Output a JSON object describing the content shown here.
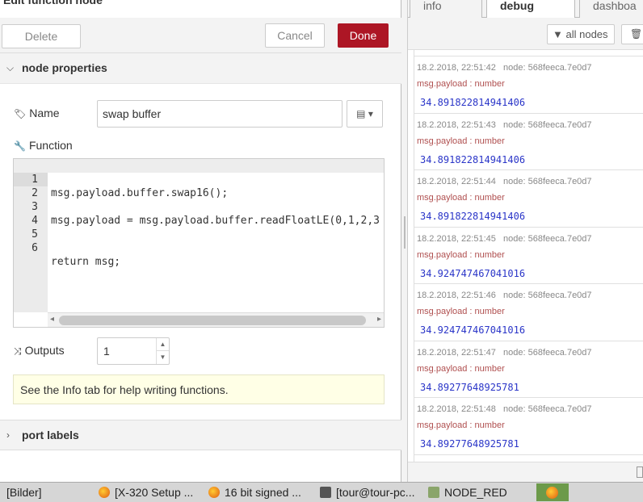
{
  "editor_tray": {
    "title": "Edit function node",
    "delete_label": "Delete",
    "cancel_label": "Cancel",
    "done_label": "Done",
    "section_properties": "node properties",
    "name_label": "Name",
    "name_value": "swap buffer",
    "function_label": "Function",
    "code_lines": [
      {
        "n": "1",
        "text": "msg.payload.buffer.swap16();"
      },
      {
        "n": "2",
        "text": ""
      },
      {
        "n": "3",
        "text": "msg.payload = msg.payload.buffer.readFloatLE(0,1,2,3"
      },
      {
        "n": "4",
        "text": ""
      },
      {
        "n": "5",
        "text": ""
      },
      {
        "n": "6",
        "text": "return msg;"
      }
    ],
    "outputs_label": "Outputs",
    "outputs_value": "1",
    "tip": "See the Info tab for help writing functions.",
    "section_ports": "port labels"
  },
  "sidebar": {
    "tabs": [
      "info",
      "debug",
      "dashboa"
    ],
    "active_tab": "debug",
    "filter_label": "all nodes",
    "messages": [
      {
        "time": "18.2.2018, 22:51:42",
        "node": "node: 568feeca.7e0d7",
        "topic": "msg.payload : number",
        "value": "34.891822814941406"
      },
      {
        "time": "18.2.2018, 22:51:43",
        "node": "node: 568feeca.7e0d7",
        "topic": "msg.payload : number",
        "value": "34.891822814941406"
      },
      {
        "time": "18.2.2018, 22:51:44",
        "node": "node: 568feeca.7e0d7",
        "topic": "msg.payload : number",
        "value": "34.891822814941406"
      },
      {
        "time": "18.2.2018, 22:51:45",
        "node": "node: 568feeca.7e0d7",
        "topic": "msg.payload : number",
        "value": "34.924747467041016"
      },
      {
        "time": "18.2.2018, 22:51:46",
        "node": "node: 568feeca.7e0d7",
        "topic": "msg.payload : number",
        "value": "34.924747467041016"
      },
      {
        "time": "18.2.2018, 22:51:47",
        "node": "node: 568feeca.7e0d7",
        "topic": "msg.payload : number",
        "value": "34.89277648925781"
      },
      {
        "time": "18.2.2018, 22:51:48",
        "node": "node: 568feeca.7e0d7",
        "topic": "msg.payload : number",
        "value": "34.89277648925781"
      }
    ]
  },
  "taskbar": {
    "items": [
      "[Bilder]",
      "[X-320 Setup ...",
      "16 bit signed ...",
      "[tour@tour-pc...",
      "NODE_RED"
    ]
  },
  "colors": {
    "done": "#ad1625",
    "payload_value": "#2a35c8",
    "topic": "#b05050"
  }
}
